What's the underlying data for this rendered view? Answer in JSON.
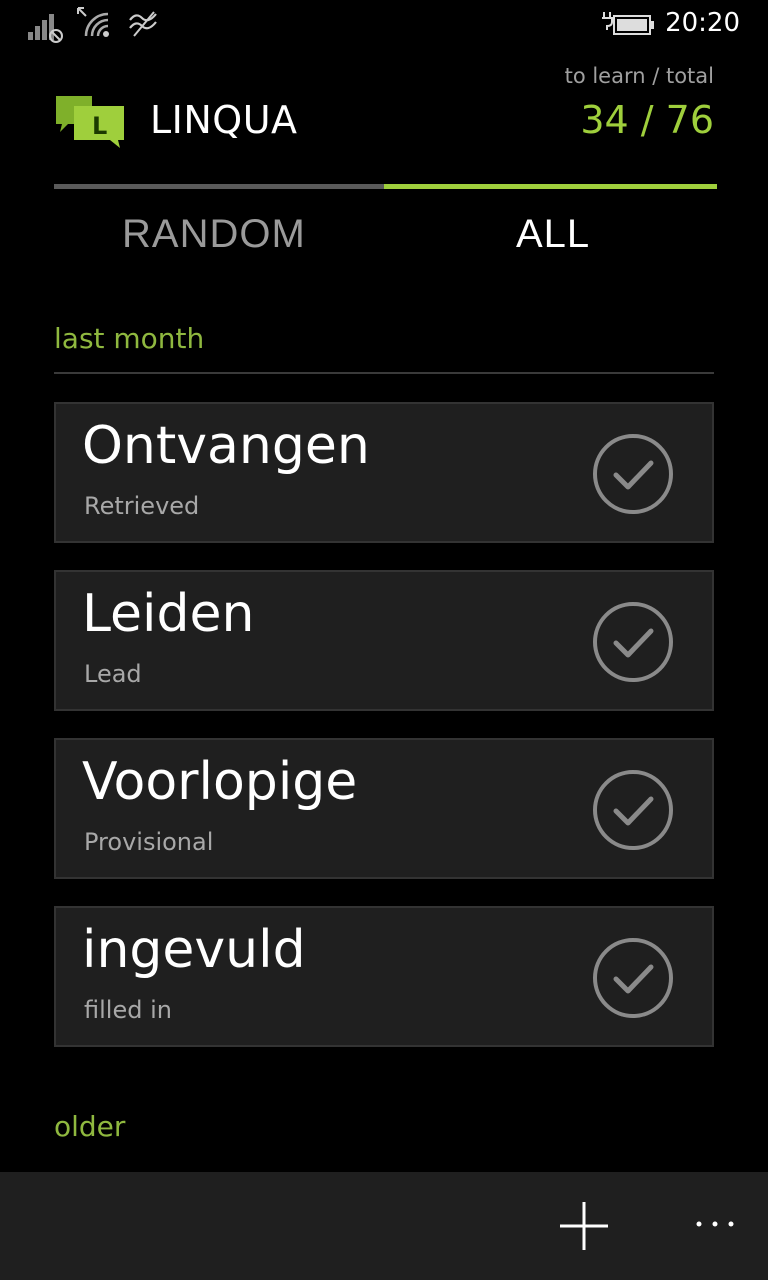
{
  "status_bar": {
    "time": "20:20",
    "icons": [
      "signal-off-icon",
      "wifi-icon",
      "data-icon",
      "battery-charging-icon"
    ]
  },
  "header": {
    "logo_letter": "L",
    "app_name": "LINQUA",
    "counter_caption": "to learn / total",
    "counter_value": "34 / 76"
  },
  "pivot": {
    "tabs": [
      {
        "label": "RANDOM",
        "selected": false
      },
      {
        "label": "ALL",
        "selected": true
      }
    ]
  },
  "groups": {
    "last_month": "last month",
    "older": "older"
  },
  "words": [
    {
      "term": "Ontvangen",
      "translation": "Retrieved",
      "icon": "check-circle-icon"
    },
    {
      "term": "Leiden",
      "translation": "Lead",
      "icon": "check-circle-icon"
    },
    {
      "term": "Voorlopige",
      "translation": "Provisional",
      "icon": "check-circle-icon"
    },
    {
      "term": "ingevuld",
      "translation": "filled in",
      "icon": "check-circle-icon"
    }
  ],
  "app_bar": {
    "buttons": [
      "add-icon",
      "more-icon"
    ]
  },
  "colors": {
    "accent": "#9fcf3c",
    "group_header": "#8fb83f",
    "card_background": "#1f1f1f",
    "background": "#000000"
  }
}
